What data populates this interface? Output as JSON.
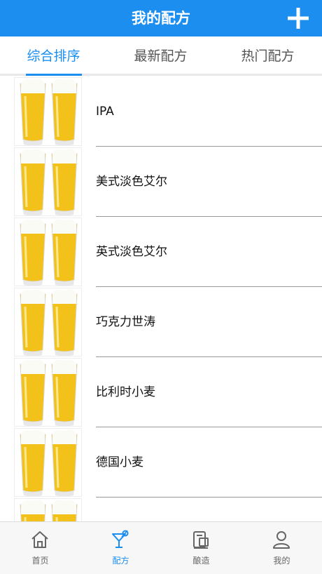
{
  "header": {
    "title": "我的配方",
    "add_icon": "plus-icon"
  },
  "tabs": [
    {
      "label": "综合排序",
      "active": true
    },
    {
      "label": "最新配方",
      "active": false
    },
    {
      "label": "热门配方",
      "active": false
    }
  ],
  "recipes": [
    {
      "name": "IPA",
      "image": "beer-glasses-image"
    },
    {
      "name": "美式淡色艾尔",
      "image": "beer-glasses-image"
    },
    {
      "name": "英式淡色艾尔",
      "image": "beer-glasses-image"
    },
    {
      "name": "巧克力世涛",
      "image": "beer-glasses-image"
    },
    {
      "name": "比利时小麦",
      "image": "beer-glasses-image"
    },
    {
      "name": "德国小麦",
      "image": "beer-glasses-image"
    },
    {
      "name": "",
      "image": "beer-glasses-image"
    }
  ],
  "tabbar": [
    {
      "label": "首页",
      "icon": "home-icon",
      "active": false
    },
    {
      "label": "配方",
      "icon": "cocktail-icon",
      "active": true
    },
    {
      "label": "酿造",
      "icon": "brewing-icon",
      "active": false
    },
    {
      "label": "我的",
      "icon": "user-icon",
      "active": false
    }
  ],
  "colors": {
    "primary": "#1b8ef0",
    "beer": "#f2c21b",
    "divider": "#9a9a9a"
  }
}
